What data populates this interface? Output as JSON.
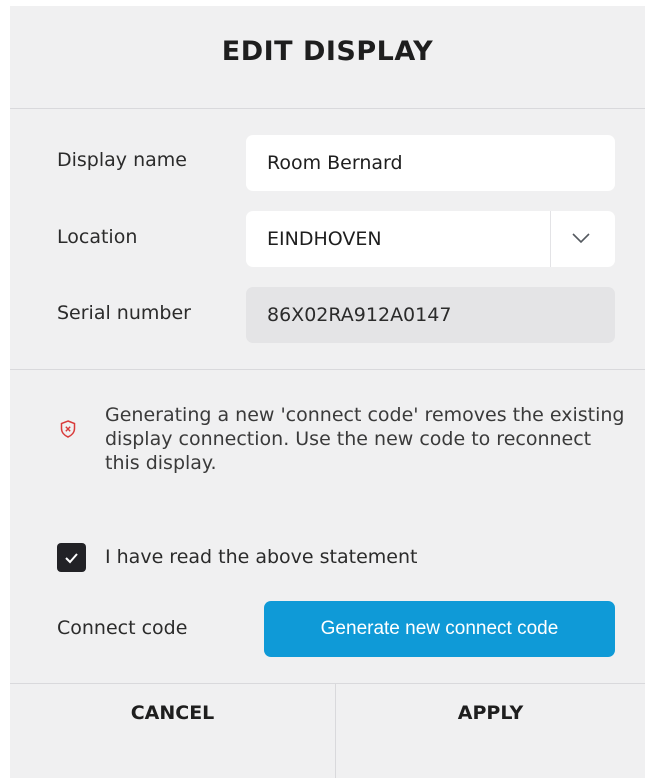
{
  "dialog": {
    "title": "EDIT DISPLAY"
  },
  "form": {
    "display_name": {
      "label": "Display name",
      "value": "Room Bernard"
    },
    "location": {
      "label": "Location",
      "value": "EINDHOVEN",
      "icon": "chevron-down-icon"
    },
    "serial_number": {
      "label": "Serial number",
      "value": "86X02RA912A0147"
    }
  },
  "warning": {
    "icon": "shield-icon",
    "text": "Generating a new 'connect code' removes the existing display connection. Use the new code to reconnect this display."
  },
  "acknowledge": {
    "checked": true,
    "label": "I have read the above statement"
  },
  "connect_code": {
    "label": "Connect code",
    "button_label": "Generate new connect code"
  },
  "footer": {
    "cancel_label": "CANCEL",
    "apply_label": "APPLY"
  },
  "colors": {
    "accent": "#0f9ad7",
    "warning_icon": "#d93a3a",
    "dialog_background": "#f0f0f1"
  }
}
